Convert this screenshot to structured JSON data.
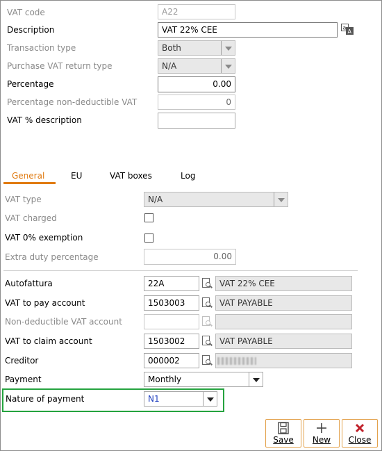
{
  "header_fields": {
    "vat_code_label": "VAT code",
    "vat_code_value": "A22",
    "description_label": "Description",
    "description_value": "VAT 22% CEE",
    "transaction_type_label": "Transaction type",
    "transaction_type_value": "Both",
    "purchase_vat_return_label": "Purchase VAT return type",
    "purchase_vat_return_value": "N/A",
    "percentage_label": "Percentage",
    "percentage_value": "0.00",
    "pct_non_deductible_label": "Percentage non-deductible VAT",
    "pct_non_deductible_value": "0",
    "vat_pct_description_label": "VAT % description",
    "vat_pct_description_value": ""
  },
  "tabs": [
    {
      "label": "General",
      "active": true
    },
    {
      "label": "EU",
      "active": false
    },
    {
      "label": "VAT boxes",
      "active": false
    },
    {
      "label": "Log",
      "active": false
    }
  ],
  "general": {
    "vat_type_label": "VAT type",
    "vat_type_value": "N/A",
    "vat_charged_label": "VAT charged",
    "vat_charged_checked": false,
    "vat_0_exemption_label": "VAT 0% exemption",
    "vat_0_exemption_checked": false,
    "extra_duty_label": "Extra duty percentage",
    "extra_duty_value": "0.00"
  },
  "accounts": {
    "autofattura_label": "Autofattura",
    "autofattura_code": "22A",
    "autofattura_desc": "VAT 22% CEE",
    "vat_to_pay_label": "VAT to pay account",
    "vat_to_pay_code": "1503003",
    "vat_to_pay_desc": "VAT PAYABLE",
    "non_deductible_label": "Non-deductible VAT account",
    "non_deductible_code": "",
    "non_deductible_desc": "",
    "vat_to_claim_label": "VAT to claim account",
    "vat_to_claim_code": "1503002",
    "vat_to_claim_desc": "VAT PAYABLE",
    "creditor_label": "Creditor",
    "creditor_code": "000002",
    "payment_label": "Payment",
    "payment_value": "Monthly",
    "nature_of_payment_label": "Nature of payment",
    "nature_of_payment_value": "N1"
  },
  "buttons": {
    "save": "Save",
    "new": "New",
    "close": "Close"
  },
  "colors": {
    "accent": "#e07a10",
    "highlight": "#25a33f",
    "close_icon": "#c0202a",
    "nature_value": "#1f3fbf"
  }
}
